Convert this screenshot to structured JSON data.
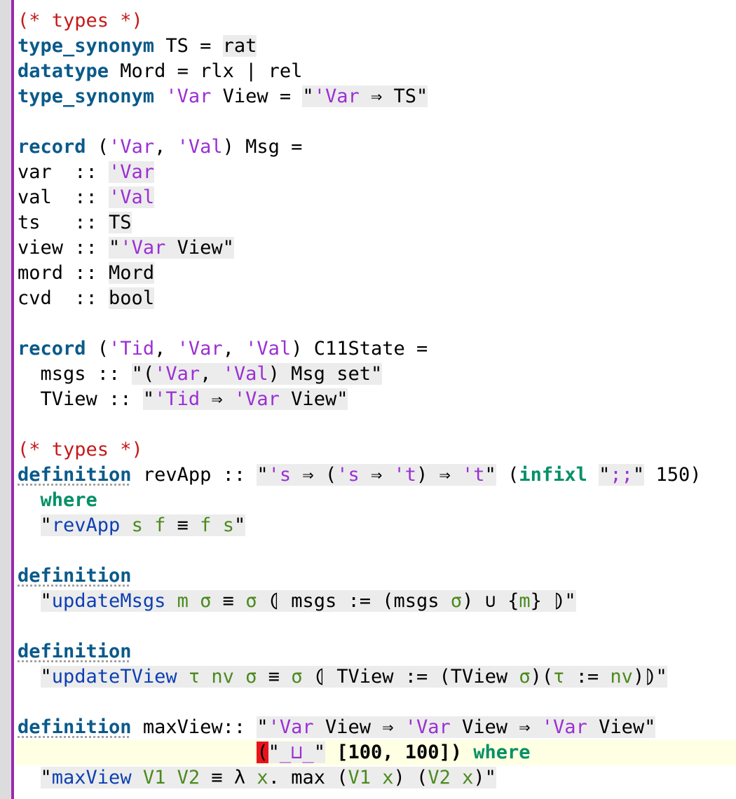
{
  "colors": {
    "background": "#ffffff",
    "gutter": "#dcdcdc",
    "gutter_bar": "#9c27b0",
    "comment": "#c41a1a",
    "keyword": "#0a5a8a",
    "keyword_green": "#059066",
    "type_var": "#9b2fd4",
    "free_var": "#4b8a1e",
    "constant": "#0d3fb3",
    "current_line": "#ffffe3",
    "error": "#e8141a"
  },
  "lines": [
    [
      {
        "t": "(* types *)",
        "c": "cmt"
      }
    ],
    [
      {
        "t": "type_synonym",
        "c": "kw"
      },
      {
        "t": " TS = "
      },
      {
        "t": "rat",
        "c": "gr"
      }
    ],
    [
      {
        "t": "datatype",
        "c": "kw"
      },
      {
        "t": " Mord = rlx | rel"
      }
    ],
    [
      {
        "t": "type_synonym",
        "c": "kw"
      },
      {
        "t": " "
      },
      {
        "t": "'Var",
        "c": "tv"
      },
      {
        "t": " View = "
      },
      {
        "t": "\"",
        "c": "gr"
      },
      {
        "t": "'Var",
        "c": "tv gr"
      },
      {
        "t": " ⇒ TS\"",
        "c": "gr"
      }
    ],
    [],
    [
      {
        "t": "record",
        "c": "kw"
      },
      {
        "t": " ("
      },
      {
        "t": "'Var",
        "c": "tv"
      },
      {
        "t": ", "
      },
      {
        "t": "'Val",
        "c": "tv"
      },
      {
        "t": ") Msg ="
      }
    ],
    [
      {
        "t": "var  :: "
      },
      {
        "t": "'Var",
        "c": "tv gr"
      }
    ],
    [
      {
        "t": "val  :: "
      },
      {
        "t": "'Val",
        "c": "tv gr"
      }
    ],
    [
      {
        "t": "ts   :: "
      },
      {
        "t": "TS",
        "c": "gr"
      }
    ],
    [
      {
        "t": "view :: "
      },
      {
        "t": "\"",
        "c": "gr"
      },
      {
        "t": "'Var",
        "c": "tv gr"
      },
      {
        "t": " View\"",
        "c": "gr"
      }
    ],
    [
      {
        "t": "mord :: "
      },
      {
        "t": "Mord",
        "c": "gr"
      }
    ],
    [
      {
        "t": "cvd  :: "
      },
      {
        "t": "bool",
        "c": "gr"
      }
    ],
    [],
    [
      {
        "t": "record",
        "c": "kw"
      },
      {
        "t": " ("
      },
      {
        "t": "'Tid",
        "c": "tv"
      },
      {
        "t": ", "
      },
      {
        "t": "'Var",
        "c": "tv"
      },
      {
        "t": ", "
      },
      {
        "t": "'Val",
        "c": "tv"
      },
      {
        "t": ") C11State ="
      }
    ],
    [
      {
        "t": "  msgs :: "
      },
      {
        "t": "\"(",
        "c": "gr"
      },
      {
        "t": "'Var",
        "c": "tv gr"
      },
      {
        "t": ", ",
        "c": "gr"
      },
      {
        "t": "'Val",
        "c": "tv gr"
      },
      {
        "t": ") Msg set\"",
        "c": "gr"
      }
    ],
    [
      {
        "t": "  TView :: "
      },
      {
        "t": "\"",
        "c": "gr"
      },
      {
        "t": "'Tid",
        "c": "tv gr"
      },
      {
        "t": " ⇒ ",
        "c": "gr"
      },
      {
        "t": "'Var",
        "c": "tv gr"
      },
      {
        "t": " View\"",
        "c": "gr"
      }
    ],
    [],
    [
      {
        "t": "(* types *)",
        "c": "cmt"
      }
    ],
    [
      {
        "t": "definition",
        "c": "kw ul"
      },
      {
        "t": " revApp :: "
      },
      {
        "t": "\"",
        "c": "gr"
      },
      {
        "t": "'s",
        "c": "tv gr"
      },
      {
        "t": " ⇒ (",
        "c": "gr"
      },
      {
        "t": "'s",
        "c": "tv gr"
      },
      {
        "t": " ⇒ ",
        "c": "gr"
      },
      {
        "t": "'t",
        "c": "tv gr"
      },
      {
        "t": ") ⇒ ",
        "c": "gr"
      },
      {
        "t": "'t",
        "c": "tv gr"
      },
      {
        "t": "\"",
        "c": "gr"
      },
      {
        "t": " ("
      },
      {
        "t": "infixl",
        "c": "kw2"
      },
      {
        "t": " "
      },
      {
        "t": "\"",
        "c": "gr"
      },
      {
        "t": ";;",
        "c": "tv gr"
      },
      {
        "t": "\"",
        "c": "gr"
      },
      {
        "t": " 150)"
      }
    ],
    [
      {
        "t": "  "
      },
      {
        "t": "where",
        "c": "kw2"
      }
    ],
    [
      {
        "t": "  "
      },
      {
        "t": "\"",
        "c": "gr"
      },
      {
        "t": "revApp",
        "c": "cn gr"
      },
      {
        "t": " ",
        "c": "gr"
      },
      {
        "t": "s",
        "c": "fv gr"
      },
      {
        "t": " ",
        "c": "gr"
      },
      {
        "t": "f",
        "c": "fv gr"
      },
      {
        "t": " ≡ ",
        "c": "gr"
      },
      {
        "t": "f",
        "c": "fv gr"
      },
      {
        "t": " ",
        "c": "gr"
      },
      {
        "t": "s",
        "c": "fv gr"
      },
      {
        "t": "\"",
        "c": "gr"
      }
    ],
    [],
    [
      {
        "t": "definition",
        "c": "kw ul"
      }
    ],
    [
      {
        "t": "  "
      },
      {
        "t": "\"",
        "c": "gr"
      },
      {
        "t": "updateMsgs",
        "c": "cn gr"
      },
      {
        "t": " ",
        "c": "gr"
      },
      {
        "t": "m",
        "c": "fv gr"
      },
      {
        "t": " ",
        "c": "gr"
      },
      {
        "t": "σ",
        "c": "fv gr"
      },
      {
        "t": " ≡ ",
        "c": "gr"
      },
      {
        "t": "σ",
        "c": "fv gr"
      },
      {
        "t": " ⦇ msgs := (msgs ",
        "c": "gr"
      },
      {
        "t": "σ",
        "c": "fv gr"
      },
      {
        "t": ") ∪ {",
        "c": "gr"
      },
      {
        "t": "m",
        "c": "fv gr"
      },
      {
        "t": "} ⦈\"",
        "c": "gr"
      }
    ],
    [],
    [
      {
        "t": "definition",
        "c": "kw ul"
      }
    ],
    [
      {
        "t": "  "
      },
      {
        "t": "\"",
        "c": "gr"
      },
      {
        "t": "updateTView",
        "c": "cn gr"
      },
      {
        "t": " ",
        "c": "gr"
      },
      {
        "t": "τ",
        "c": "fv gr"
      },
      {
        "t": " ",
        "c": "gr"
      },
      {
        "t": "nv",
        "c": "fv gr"
      },
      {
        "t": " ",
        "c": "gr"
      },
      {
        "t": "σ",
        "c": "fv gr"
      },
      {
        "t": " ≡ ",
        "c": "gr"
      },
      {
        "t": "σ",
        "c": "fv gr"
      },
      {
        "t": " ⦇ TView := (TView ",
        "c": "gr"
      },
      {
        "t": "σ",
        "c": "fv gr"
      },
      {
        "t": ")(",
        "c": "gr"
      },
      {
        "t": "τ",
        "c": "fv gr"
      },
      {
        "t": " := ",
        "c": "gr"
      },
      {
        "t": "nv",
        "c": "fv gr"
      },
      {
        "t": ")⦈\"",
        "c": "gr"
      }
    ],
    [],
    [
      {
        "t": "definition",
        "c": "kw ul"
      },
      {
        "t": " maxView:: "
      },
      {
        "t": "\"",
        "c": "gr"
      },
      {
        "t": "'Var",
        "c": "tv gr"
      },
      {
        "t": " View ⇒ ",
        "c": "gr"
      },
      {
        "t": "'Var",
        "c": "tv gr"
      },
      {
        "t": " View ⇒ ",
        "c": "gr"
      },
      {
        "t": "'Var",
        "c": "tv gr"
      },
      {
        "t": " View\"",
        "c": "gr"
      }
    ],
    [
      {
        "t": "                     "
      },
      {
        "t": "(",
        "c": "err"
      },
      {
        "t": "\"",
        "c": "gr"
      },
      {
        "t": "_⊔_",
        "c": "tv gr"
      },
      {
        "t": "\"",
        "c": "gr"
      },
      {
        "t": " [100, 100]) ",
        "c": "bold"
      },
      {
        "t": "where",
        "c": "kw2"
      }
    ],
    [
      {
        "t": "  "
      },
      {
        "t": "\"",
        "c": "gr"
      },
      {
        "t": "maxView",
        "c": "cn gr"
      },
      {
        "t": " ",
        "c": "gr"
      },
      {
        "t": "V1",
        "c": "fv gr"
      },
      {
        "t": " ",
        "c": "gr"
      },
      {
        "t": "V2",
        "c": "fv gr"
      },
      {
        "t": " ≡ λ ",
        "c": "gr"
      },
      {
        "t": "x",
        "c": "fv gr"
      },
      {
        "t": ". max (",
        "c": "gr"
      },
      {
        "t": "V1",
        "c": "fv gr"
      },
      {
        "t": " ",
        "c": "gr"
      },
      {
        "t": "x",
        "c": "fv gr"
      },
      {
        "t": ") (",
        "c": "gr"
      },
      {
        "t": "V2",
        "c": "fv gr"
      },
      {
        "t": " ",
        "c": "gr"
      },
      {
        "t": "x",
        "c": "fv gr"
      },
      {
        "t": ")\"",
        "c": "gr"
      }
    ]
  ]
}
